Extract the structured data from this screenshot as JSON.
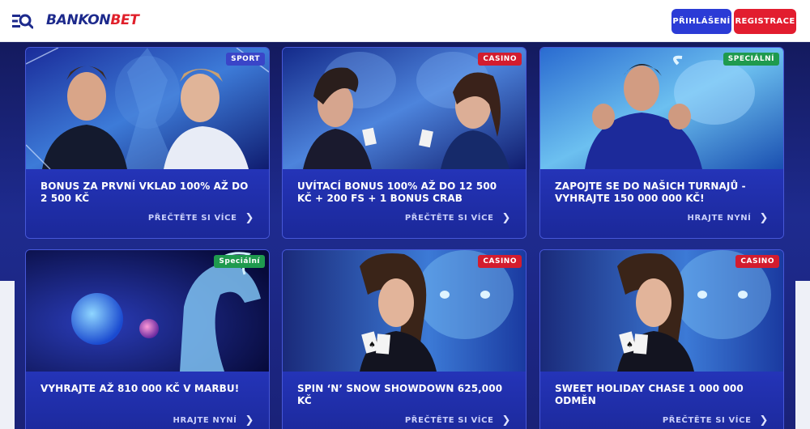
{
  "header": {
    "brand_part1": "BANKON",
    "brand_part2": "BET",
    "login_label": "PŘIHLÁŠENÍ",
    "register_label": "REGISTRACE",
    "menu_icon": "menu-search-icon"
  },
  "colors": {
    "brand_blue": "#1d2a8c",
    "brand_red": "#e0202b",
    "login_button": "#2b3bd6",
    "register_button": "#e21d2f",
    "badge_sport": "#3a45c8",
    "badge_casino": "#d31c2e",
    "badge_special": "#1f9a4e"
  },
  "cards": [
    {
      "badge": "SPORT",
      "title": "BONUS ZA PRVNÍ VKLAD 100% AŽ DO 2 500 KČ",
      "cta": "PŘEČTĚTE SI VÍCE"
    },
    {
      "badge": "CASINO",
      "title": "UVÍTACÍ BONUS 100% AŽ DO 12 500 KČ + 200 FS + 1 BONUS CRAB",
      "cta": "PŘEČTĚTE SI VÍCE"
    },
    {
      "badge": "SPECIÁLNÍ",
      "title": "ZAPOJTE SE DO NAŠICH TURNAJŮ - VYHRAJTE 150 000 000 KČ!",
      "cta": "HRAJTE NYNÍ"
    },
    {
      "badge": "Speciální",
      "title": "VYHRAJTE AŽ 810 000 KČ V MARBU!",
      "cta": "HRAJTE NYNÍ"
    },
    {
      "badge": "CASINO",
      "title": "SPIN ‘N’ SNOW SHOWDOWN 625,000 KČ",
      "cta": "PŘEČTĚTE SI VÍCE"
    },
    {
      "badge": "CASINO",
      "title": "SWEET HOLIDAY CHASE 1 000 000 ODMĚN",
      "cta": "PŘEČTĚTE SI VÍCE"
    }
  ]
}
